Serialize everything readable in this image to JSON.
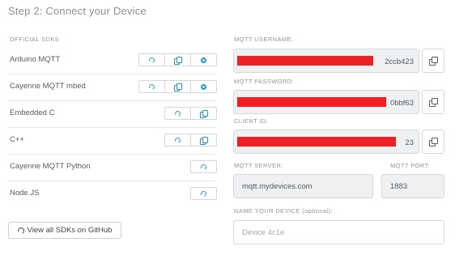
{
  "step_title": "Step 2: Connect your Device",
  "official_sdks_label": "OFFICIAL SDKS",
  "sdks": [
    {
      "name": "Arduino MQTT",
      "buttons": [
        "github-icon",
        "copy-icon",
        "download-icon"
      ]
    },
    {
      "name": "Cayenne MQTT mbed",
      "buttons": [
        "github-icon",
        "copy-icon",
        "download-icon"
      ]
    },
    {
      "name": "Embedded C",
      "buttons": [
        "github-icon",
        "copy-icon"
      ]
    },
    {
      "name": "C++",
      "buttons": [
        "github-icon",
        "copy-icon"
      ]
    },
    {
      "name": "Cayenne MQTT Python",
      "buttons": [
        "github-icon"
      ]
    },
    {
      "name": "Node.JS",
      "buttons": [
        "github-icon"
      ]
    }
  ],
  "github_all_label": "View all SDKs on GitHub",
  "mqtt_username": {
    "label": "MQTT USERNAME:",
    "visible_tail": "2ccb423"
  },
  "mqtt_password": {
    "label": "MQTT PASSWORD:",
    "visible_tail": "0bbf63"
  },
  "client_id": {
    "label": "CLIENT ID:",
    "visible_tail": "23"
  },
  "mqtt_server": {
    "label": "MQTT SERVER:",
    "value": "mqtt.mydevices.com"
  },
  "mqtt_port": {
    "label": "MQTT PORT:",
    "value": "1883"
  },
  "device_name": {
    "label": "NAME YOUR DEVICE (optional):",
    "placeholder": "Device 4c1e"
  },
  "colors": {
    "accent": "#2196d3",
    "redaction": "#ee2026",
    "field_bg": "#eef0f2"
  }
}
